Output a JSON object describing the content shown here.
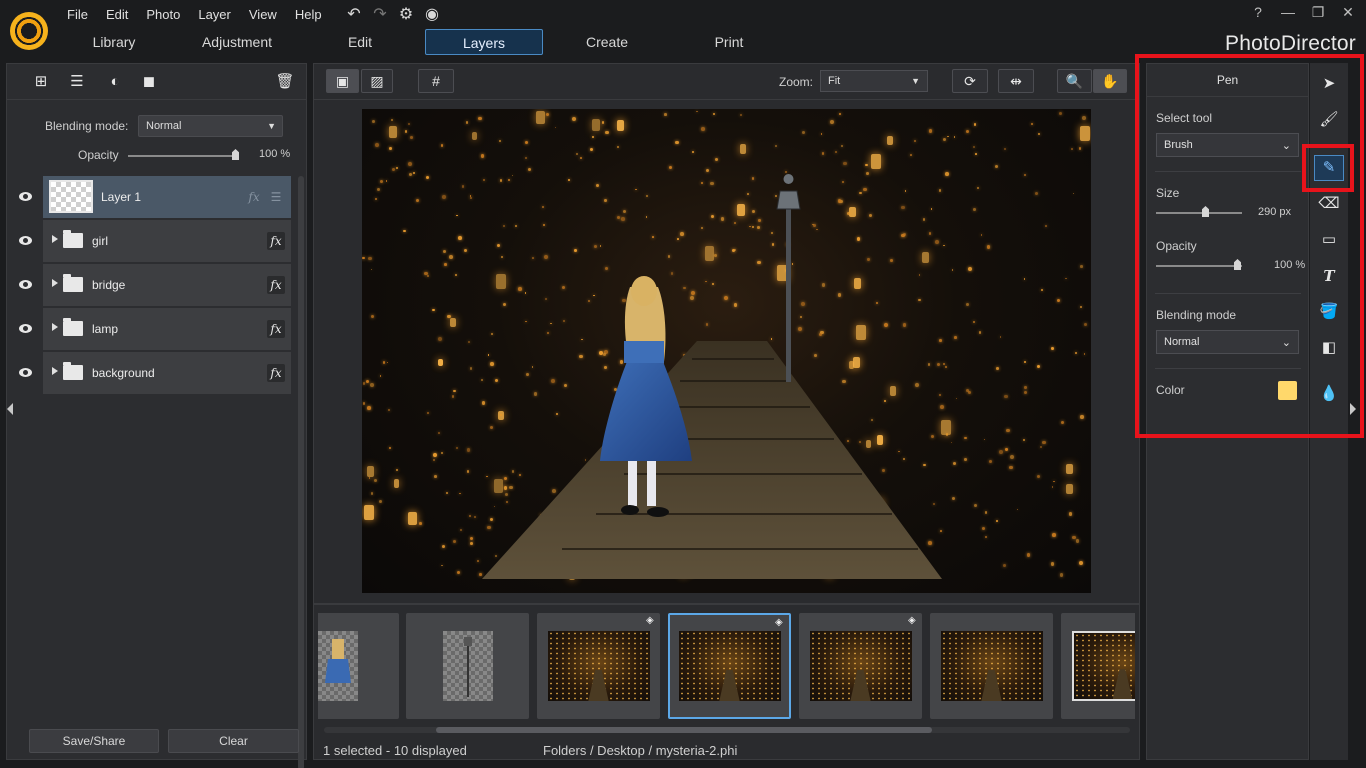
{
  "app": {
    "brand": "PhotoDirector"
  },
  "menu": [
    "File",
    "Edit",
    "Photo",
    "Layer",
    "View",
    "Help"
  ],
  "quick_tools": [
    {
      "icon": "undo-icon",
      "glyph": "↶"
    },
    {
      "icon": "redo-icon",
      "glyph": "↷"
    },
    {
      "icon": "settings-gear-icon",
      "glyph": "⚙"
    },
    {
      "icon": "notification-bell-icon",
      "glyph": "◉"
    }
  ],
  "main_tabs": [
    {
      "label": "Library",
      "active": false
    },
    {
      "label": "Adjustment",
      "active": false
    },
    {
      "label": "Edit",
      "active": false
    },
    {
      "label": "Layers",
      "active": true
    },
    {
      "label": "Create",
      "active": false
    },
    {
      "label": "Print",
      "active": false
    }
  ],
  "window_controls": [
    {
      "icon": "help-icon",
      "glyph": "?"
    },
    {
      "icon": "minimize-icon",
      "glyph": "—"
    },
    {
      "icon": "restore-icon",
      "glyph": "❐"
    },
    {
      "icon": "close-icon",
      "glyph": "✕"
    }
  ],
  "layers_panel": {
    "toolbar_icons": [
      {
        "icon": "add-layer-icon",
        "glyph": "⊞"
      },
      {
        "icon": "layer-menu-icon",
        "glyph": "☰"
      },
      {
        "icon": "adjustment-layer-icon",
        "glyph": "◐"
      },
      {
        "icon": "layer-mask-icon",
        "glyph": "◼"
      },
      {
        "icon": "delete-layer-icon",
        "glyph": "🗑"
      }
    ],
    "blending_mode_label": "Blending mode:",
    "blending_mode_value": "Normal",
    "opacity_label": "Opacity",
    "opacity_value": "100 %",
    "opacity_fraction": 1.0,
    "layers": [
      {
        "name": "Layer 1",
        "type": "layer",
        "selected": true,
        "visible": true
      },
      {
        "name": "girl",
        "type": "group",
        "selected": false,
        "visible": true
      },
      {
        "name": "bridge",
        "type": "group",
        "selected": false,
        "visible": true
      },
      {
        "name": "lamp",
        "type": "group",
        "selected": false,
        "visible": true
      },
      {
        "name": "background",
        "type": "group",
        "selected": false,
        "visible": true
      }
    ],
    "fx_label": "fx",
    "save_share_label": "Save/Share",
    "clear_label": "Clear"
  },
  "canvas": {
    "zoom_label": "Zoom:",
    "zoom_value": "Fit",
    "toolbar_icons": [
      {
        "icon": "single-view-icon",
        "glyph": "▣"
      },
      {
        "icon": "compare-view-icon",
        "glyph": "▨"
      },
      {
        "icon": "grid-icon",
        "glyph": "#"
      },
      {
        "icon": "rotate-icon",
        "glyph": "⟳"
      },
      {
        "icon": "flip-icon",
        "glyph": "⇹"
      },
      {
        "icon": "zoom-icon",
        "glyph": "🔍"
      },
      {
        "icon": "pan-hand-icon",
        "glyph": "✋"
      }
    ]
  },
  "filmstrip": {
    "items": [
      {
        "kind": "girl-cutout",
        "stacked": false,
        "active": false
      },
      {
        "kind": "lamp-cutout",
        "stacked": false,
        "active": false
      },
      {
        "kind": "scene",
        "stacked": true,
        "active": false
      },
      {
        "kind": "scene",
        "stacked": true,
        "active": true
      },
      {
        "kind": "scene",
        "stacked": true,
        "active": false
      },
      {
        "kind": "scene",
        "stacked": false,
        "active": false
      },
      {
        "kind": "scene",
        "stacked": false,
        "active": false
      }
    ],
    "status": "1 selected - 10 displayed",
    "path": "Folders / Desktop / mysteria-2.phi"
  },
  "pen_panel": {
    "title": "Pen",
    "select_tool_label": "Select tool",
    "select_tool_value": "Brush",
    "size_label": "Size",
    "size_value": "290 px",
    "size_fraction": 0.56,
    "opacity_label": "Opacity",
    "opacity_value": "100 %",
    "opacity_fraction": 1.0,
    "blending_mode_label": "Blending mode",
    "blending_mode_value": "Normal",
    "color_label": "Color",
    "color_value": "#ffd86b"
  },
  "tools": [
    {
      "icon": "select-arrow-icon",
      "glyph": "➤",
      "active": false
    },
    {
      "icon": "layer-brush-icon",
      "glyph": "🖌",
      "active": false
    },
    {
      "icon": "pen-icon",
      "glyph": "✎",
      "active": true
    },
    {
      "icon": "eraser-icon",
      "glyph": "⌫",
      "active": false
    },
    {
      "icon": "rectangle-shape-icon",
      "glyph": "▭",
      "active": false
    },
    {
      "icon": "text-tool-icon",
      "glyph": "T",
      "active": false
    },
    {
      "icon": "paint-bucket-icon",
      "glyph": "🪣",
      "active": false
    },
    {
      "icon": "gradient-icon",
      "glyph": "◧",
      "active": false
    },
    {
      "icon": "water-drop-icon",
      "glyph": "💧",
      "active": false
    }
  ],
  "annotation": {
    "highlight_color": "#e8131b"
  }
}
